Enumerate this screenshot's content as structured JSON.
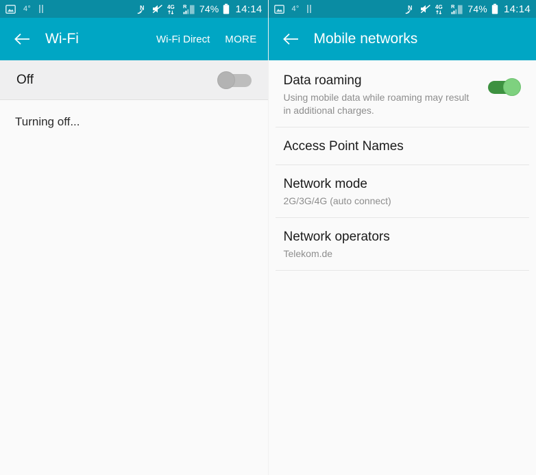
{
  "status_bar": {
    "left_icons": [
      {
        "name": "screenshot-icon",
        "label": "screenshot"
      },
      {
        "name": "temperature-indicator",
        "label": "4°"
      },
      {
        "name": "pause-icon",
        "label": "pause"
      }
    ],
    "temperature": "4°",
    "right_icons": [
      {
        "name": "nfc-icon",
        "label": "NFC"
      },
      {
        "name": "mute-icon",
        "label": "sound muted"
      },
      {
        "name": "mobile-data-4g-icon",
        "label": "4G"
      },
      {
        "name": "signal-roaming-icon",
        "label": "R"
      }
    ],
    "network_type": "4G",
    "roaming_letter": "R",
    "battery_percent": "74%",
    "time": "14:14"
  },
  "colors": {
    "status_bar": "#0a8ca3",
    "app_bar": "#00a6c4",
    "page_background": "#fafafa",
    "master_row_background": "#efeff0",
    "switch_on_track": "#3d9140",
    "switch_on_knob": "#7ed17f",
    "switch_off_track": "#bdbdbd",
    "switch_off_knob": "#b3b3b3",
    "primary_text": "#1b1b1b",
    "secondary_text": "#8d8d8d"
  },
  "wifi_screen": {
    "app_bar": {
      "back_label": "Back",
      "title": "Wi-Fi",
      "actions": [
        {
          "name": "wifi-direct",
          "label": "Wi-Fi Direct"
        },
        {
          "name": "more",
          "label": "MORE"
        }
      ]
    },
    "master_toggle": {
      "label": "Off",
      "state": "off"
    },
    "status_text": "Turning off..."
  },
  "mobile_networks_screen": {
    "app_bar": {
      "back_label": "Back",
      "title": "Mobile networks",
      "actions": []
    },
    "items": [
      {
        "name": "data-roaming",
        "title": "Data roaming",
        "subtitle": "Using mobile data while roaming may result in additional charges.",
        "control": "switch",
        "state": "on"
      },
      {
        "name": "access-point-names",
        "title": "Access Point Names",
        "subtitle": "",
        "control": "none",
        "state": ""
      },
      {
        "name": "network-mode",
        "title": "Network mode",
        "subtitle": "2G/3G/4G (auto connect)",
        "control": "none",
        "state": ""
      },
      {
        "name": "network-operators",
        "title": "Network operators",
        "subtitle": "Telekom.de",
        "control": "none",
        "state": ""
      }
    ]
  }
}
